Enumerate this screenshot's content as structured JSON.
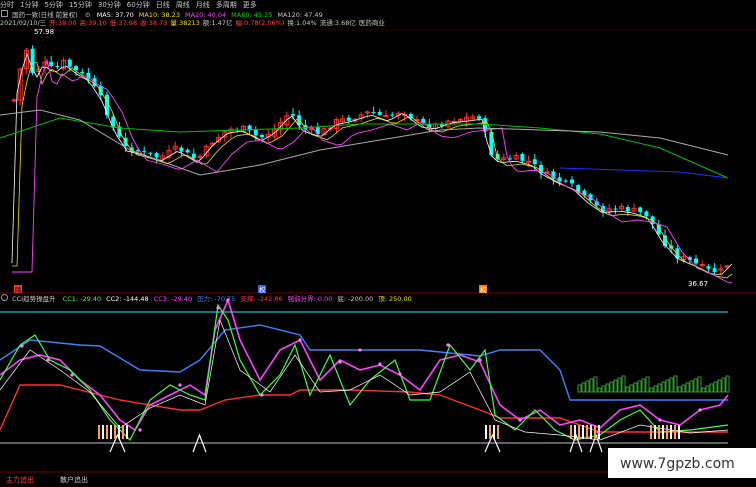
{
  "tabs": [
    "分时",
    "1分钟",
    "5分钟",
    "15分钟",
    "30分钟",
    "60分钟",
    "日线",
    "周线",
    "月线",
    "多周期",
    "更多"
  ],
  "stock": {
    "name_label": "国药一致(日线 前复权)",
    "ma_legend": [
      {
        "label": "MA5: 37.70",
        "color": "#ffffff"
      },
      {
        "label": "MA10: 38.23",
        "color": "#f0e000"
      },
      {
        "label": "MA20: 40.04",
        "color": "#ff40ff"
      },
      {
        "label": "MA60: 45.25",
        "color": "#00dd00"
      },
      {
        "label": "MA120: 47.49",
        "color": "#c8c8c8"
      }
    ]
  },
  "quote": {
    "items": [
      {
        "text": "2021/02/10/三",
        "color": "#c8c8c8"
      },
      {
        "text": "开:38.00",
        "color": "#ff4040"
      },
      {
        "text": "高:39.10",
        "color": "#ff4040"
      },
      {
        "text": "低:37.98",
        "color": "#ff4040"
      },
      {
        "text": "收:38.73",
        "color": "#ff4040"
      },
      {
        "text": "量:38213",
        "color": "#f0e000"
      },
      {
        "text": "额:1.47亿",
        "color": "#c8c8c8"
      },
      {
        "text": "幅:0.78(2.06%)",
        "color": "#ff4040"
      },
      {
        "text": "换:1.04%",
        "color": "#c8c8c8"
      },
      {
        "text": "流通:3.68亿",
        "color": "#c8c8c8"
      },
      {
        "text": "医药商业",
        "color": "#c8c8c8"
      }
    ]
  },
  "price_labels": {
    "high": "57.98",
    "low": "36.67"
  },
  "markers": {
    "m1": "除",
    "m2": "权",
    "m3": "权"
  },
  "indicator": {
    "name": "CCI趋势操盘升",
    "items": [
      {
        "text": "CC1: -29.40",
        "color": "#40ff40"
      },
      {
        "text": "CC2: -144.48",
        "color": "#ffffff"
      },
      {
        "text": "CC3: -29.40",
        "color": "#ff40ff"
      },
      {
        "text": "压力: -70.75",
        "color": "#4080ff"
      },
      {
        "text": "支撑: -242.86",
        "color": "#ff3030"
      },
      {
        "text": "强弱分界: 0.00",
        "color": "#ff40ff"
      },
      {
        "text": "底: -200.00",
        "color": "#c8c8c8"
      },
      {
        "text": "顶: 250.00",
        "color": "#f0e000"
      }
    ]
  },
  "bottom_tabs": [
    {
      "text": "主力追出",
      "color": "#ff4040"
    },
    {
      "text": "散户追出",
      "color": "#c8c8c8"
    }
  ],
  "watermark": "www.7gpzb.com",
  "colors": {
    "up": "#ff3030",
    "down": "#00ffff",
    "bg": "#000000"
  }
}
